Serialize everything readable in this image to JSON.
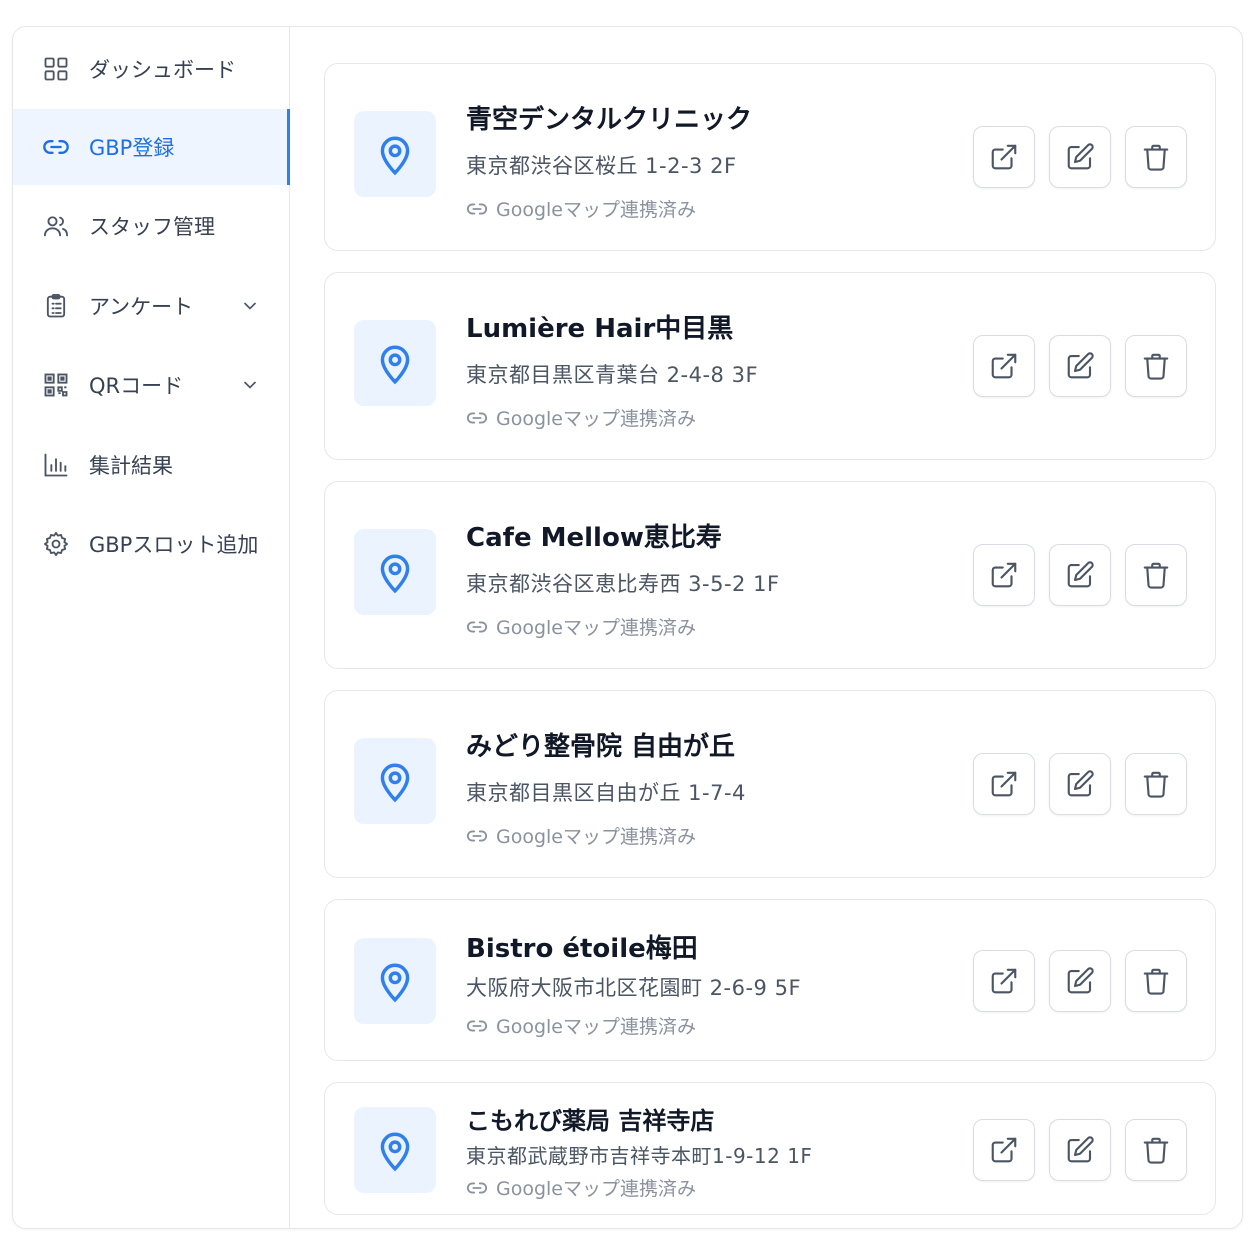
{
  "sidebar": {
    "items": [
      {
        "label": "ダッシュボード",
        "icon": "grid-icon"
      },
      {
        "label": "GBP登録",
        "icon": "link-icon",
        "active": true
      },
      {
        "label": "スタッフ管理",
        "icon": "users-icon"
      },
      {
        "label": "アンケート",
        "icon": "clipboard-icon",
        "expandable": true
      },
      {
        "label": "QRコード",
        "icon": "qr-code-icon",
        "expandable": true
      },
      {
        "label": "集計結果",
        "icon": "bar-chart-icon"
      },
      {
        "label": "GBPスロット追加",
        "icon": "gear-icon"
      }
    ]
  },
  "colors": {
    "accent": "#2f80ed",
    "active_bg": "#eef5ff",
    "pin_bg": "#eaf3ff"
  },
  "locations": [
    {
      "name": "青空デンタルクリニック",
      "address": "東京都渋谷区桜丘 1-2-3 2F",
      "status": "Googleマップ連携済み"
    },
    {
      "name": "Lumière Hair中目黒",
      "address": "東京都目黒区青葉台 2-4-8 3F",
      "status": "Googleマップ連携済み"
    },
    {
      "name": "Cafe Mellow恵比寿",
      "address": "東京都渋谷区恵比寿西 3-5-2 1F",
      "status": "Googleマップ連携済み"
    },
    {
      "name": "みどり整骨院 自由が丘",
      "address": "東京都目黒区自由が丘 1-7-4",
      "status": "Googleマップ連携済み"
    },
    {
      "name": "Bistro étoile梅田",
      "address": "大阪府大阪市北区花園町 2-6-9 5F",
      "status": "Googleマップ連携済み"
    },
    {
      "name": "こもれび薬局 吉祥寺店",
      "address": "東京都武蔵野市吉祥寺本町1-9-12 1F",
      "status": "Googleマップ連携済み"
    }
  ],
  "actions": [
    "external-link-icon",
    "edit-icon",
    "trash-icon"
  ]
}
